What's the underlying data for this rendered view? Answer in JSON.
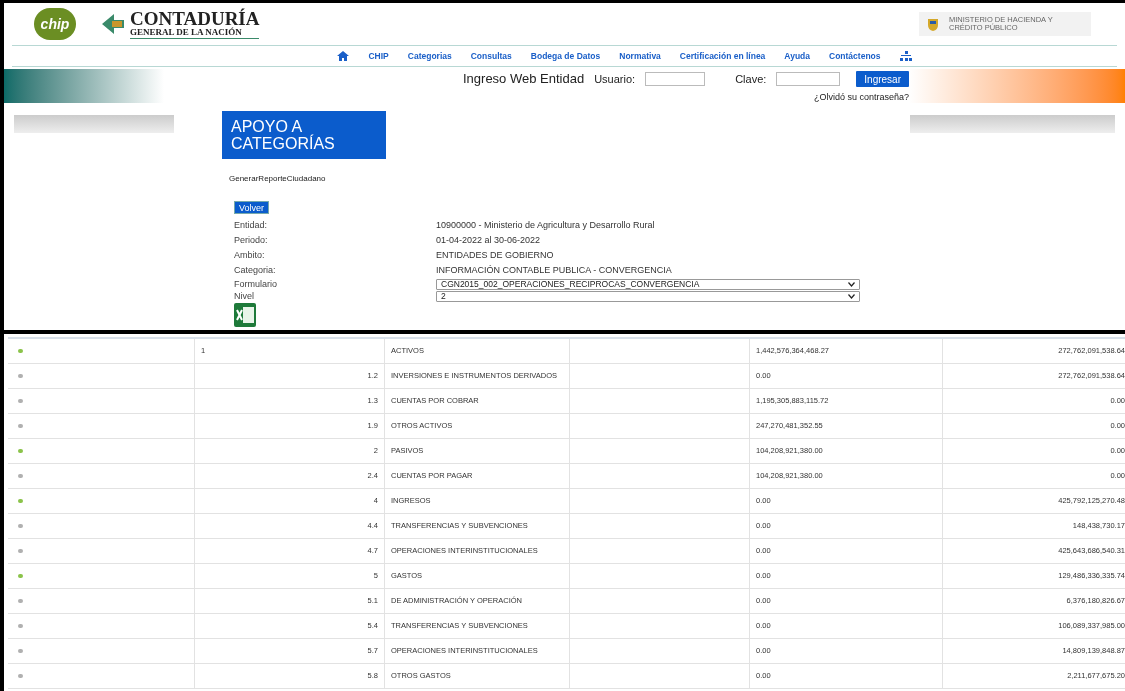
{
  "header": {
    "logo_short": "chip",
    "logo_title": "CONTADURÍA",
    "logo_subtitle": "GENERAL DE LA NACIÓN",
    "ministry": "MINISTERIO DE HACIENDA Y CRÉDITO PÚBLICO"
  },
  "nav": [
    "CHIP",
    "Categorias",
    "Consultas",
    "Bodega de Datos",
    "Normativa",
    "Certificación en línea",
    "Ayuda",
    "Contáctenos"
  ],
  "login": {
    "title": "Ingreso Web Entidad",
    "user_label": "Usuario:",
    "password_label": "Clave:",
    "submit": "Ingresar",
    "forgot": "¿Olvidó su contraseña?"
  },
  "section_title": "APOYO A CATEGORÍAS",
  "report_link": "GenerarReporteCiudadano",
  "back_button": "Volver",
  "details": [
    {
      "label": "Entidad:",
      "value": "10900000 - Ministerio de Agricultura y Desarrollo Rural"
    },
    {
      "label": "Periodo:",
      "value": "01-04-2022 al 30-06-2022"
    },
    {
      "label": "Ambito:",
      "value": "ENTIDADES DE GOBIERNO"
    },
    {
      "label": "Categoria:",
      "value": "INFORMACIÓN CONTABLE PUBLICA - CONVERGENCIA"
    }
  ],
  "selects": [
    {
      "label": "Formulario",
      "value": "CGN2015_002_OPERACIONES_RECIPROCAS_CONVERGENCIA"
    },
    {
      "label": "Nivel",
      "value": "2"
    }
  ],
  "rows": [
    {
      "kind": "top",
      "code": "1",
      "name": "ACTIVOS",
      "value_1": "1,442,576,364,468.27",
      "value_2": "272,762,091,538.64"
    },
    {
      "kind": "item",
      "code": "1.2",
      "name": "INVERSIONES E INSTRUMENTOS DERIVADOS",
      "value_1": "0.00",
      "value_2": "272,762,091,538.64"
    },
    {
      "kind": "item",
      "code": "1.3",
      "name": "CUENTAS POR COBRAR",
      "value_1": "1,195,305,883,115.72",
      "value_2": "0.00"
    },
    {
      "kind": "item",
      "code": "1.9",
      "name": "OTROS ACTIVOS",
      "value_1": "247,270,481,352.55",
      "value_2": "0.00"
    },
    {
      "kind": "group",
      "code": "2",
      "name": "PASIVOS",
      "value_1": "104,208,921,380.00",
      "value_2": "0.00"
    },
    {
      "kind": "item",
      "code": "2.4",
      "name": "CUENTAS POR PAGAR",
      "value_1": "104,208,921,380.00",
      "value_2": "0.00"
    },
    {
      "kind": "group",
      "code": "4",
      "name": "INGRESOS",
      "value_1": "0.00",
      "value_2": "425,792,125,270.48"
    },
    {
      "kind": "item",
      "code": "4.4",
      "name": "TRANSFERENCIAS Y SUBVENCIONES",
      "value_1": "0.00",
      "value_2": "148,438,730.17"
    },
    {
      "kind": "item",
      "code": "4.7",
      "name": "OPERACIONES INTERINSTITUCIONALES",
      "value_1": "0.00",
      "value_2": "425,643,686,540.31"
    },
    {
      "kind": "group",
      "code": "5",
      "name": "GASTOS",
      "value_1": "0.00",
      "value_2": "129,486,336,335.74"
    },
    {
      "kind": "item",
      "code": "5.1",
      "name": "DE ADMINISTRACIÓN Y OPERACIÓN",
      "value_1": "0.00",
      "value_2": "6,376,180,826.67"
    },
    {
      "kind": "item",
      "code": "5.4",
      "name": "TRANSFERENCIAS Y SUBVENCIONES",
      "value_1": "0.00",
      "value_2": "106,089,337,985.00"
    },
    {
      "kind": "item",
      "code": "5.7",
      "name": "OPERACIONES INTERINSTITUCIONALES",
      "value_1": "0.00",
      "value_2": "14,809,139,848.87"
    },
    {
      "kind": "item",
      "code": "5.8",
      "name": "OTROS GASTOS",
      "value_1": "0.00",
      "value_2": "2,211,677,675.20"
    }
  ]
}
